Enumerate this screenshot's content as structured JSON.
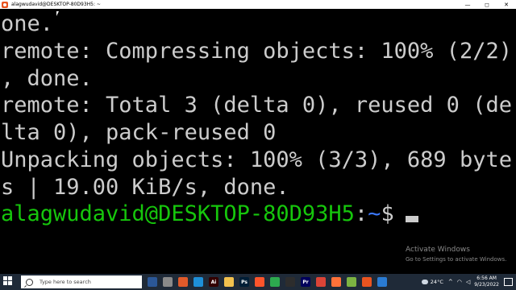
{
  "window": {
    "title": "alagwudavid@DESKTOP-80D93H5: ~",
    "controls": [
      "—",
      "◻",
      "✕"
    ]
  },
  "terminal": {
    "lines": [
      "one.",
      "remote: Compressing objects: 100% (2/2)",
      ", done.",
      "remote: Total 3 (delta 0), reused 0 (de",
      "lta 0), pack-reused 0",
      "Unpacking objects: 100% (3/3), 689 byte",
      "s | 19.00 KiB/s, done."
    ],
    "prompt": {
      "user_host": "alagwudavid@DESKTOP-80D93H5",
      "colon": ":",
      "path": "~",
      "dollar": "$"
    },
    "colors": {
      "text": "#cccccc",
      "user_host": "#16c60c",
      "path": "#3b78ff",
      "background": "#000000"
    }
  },
  "watermark": {
    "title": "Activate Windows",
    "subtitle": "Go to Settings to activate Windows."
  },
  "taskbar": {
    "search_placeholder": "Type here to search",
    "apps": [
      {
        "name": "task-view-icon",
        "glyph": "",
        "color": "#2b5797"
      },
      {
        "name": "camera-icon",
        "glyph": "",
        "color": "#8a8a8a"
      },
      {
        "name": "mail-icon",
        "glyph": "",
        "color": "#e05a2a"
      },
      {
        "name": "edge-icon",
        "glyph": "",
        "color": "#1e8fd8"
      },
      {
        "name": "illustrator-icon",
        "glyph": "Ai",
        "color": "#330000"
      },
      {
        "name": "folder-icon",
        "glyph": "",
        "color": "#f2c14e"
      },
      {
        "name": "photoshop-icon",
        "glyph": "Ps",
        "color": "#001e36"
      },
      {
        "name": "brave-icon",
        "glyph": "",
        "color": "#fb542b"
      },
      {
        "name": "chrome-icon",
        "glyph": "",
        "color": "#2da94f"
      },
      {
        "name": "terminal-icon",
        "glyph": "",
        "color": "#2d2d2d"
      },
      {
        "name": "premiere-icon",
        "glyph": "Pr",
        "color": "#00005b"
      },
      {
        "name": "chrome-alt-icon",
        "glyph": "",
        "color": "#db4437"
      },
      {
        "name": "firefox-icon",
        "glyph": "",
        "color": "#ff7139"
      },
      {
        "name": "app-green-icon",
        "glyph": "",
        "color": "#7cb342"
      },
      {
        "name": "ubuntu-icon",
        "glyph": "",
        "color": "#e95420"
      },
      {
        "name": "vscode-icon",
        "glyph": "",
        "color": "#2a7bd3"
      }
    ],
    "weather": "24°C",
    "clock_time": "6:56 AM",
    "clock_date": "9/23/2022"
  }
}
